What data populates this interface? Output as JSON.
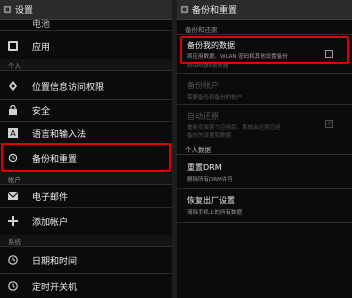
{
  "left": {
    "title": "设置",
    "partial_top_item": "电池",
    "items": {
      "apps": "应用",
      "location": "位置信息访问权限",
      "security": "安全",
      "language": "语言和输入法",
      "backup": "备份和重置",
      "email": "电子邮件",
      "add_account": "添加帐户",
      "datetime": "日期和时间",
      "schedule_power": "定时开关机"
    },
    "sections": {
      "personal": "个人",
      "accounts": "帐户",
      "system": "系统"
    }
  },
  "right": {
    "title": "备份和重置",
    "sections": {
      "backup_restore": "备份和还原",
      "personal_data": "个人数据"
    },
    "backup_my_data": {
      "title": "备份我的数据",
      "subtitle": "将应用数据、WLAN 密码和其他设置备份",
      "subtitle_overflow": "到Google服务器"
    },
    "backup_account": {
      "title": "备份帐户",
      "subtitle": "需要备份到备份的帐户"
    },
    "auto_restore": {
      "title": "自动还原",
      "subtitle_line1": "重新安装某个应用后，系统会还原已经",
      "subtitle_line2": "备份的设置和数据"
    },
    "reset_drm": {
      "title": "重置DRM",
      "subtitle": "删除所有DRM许可"
    },
    "factory_reset": {
      "title": "恢复出厂设置",
      "subtitle": "清除手机上的所有数据"
    }
  },
  "colors": {
    "highlight": "#e00000",
    "background": "#0b0b0b",
    "title_bar": "#2b2b2b"
  }
}
